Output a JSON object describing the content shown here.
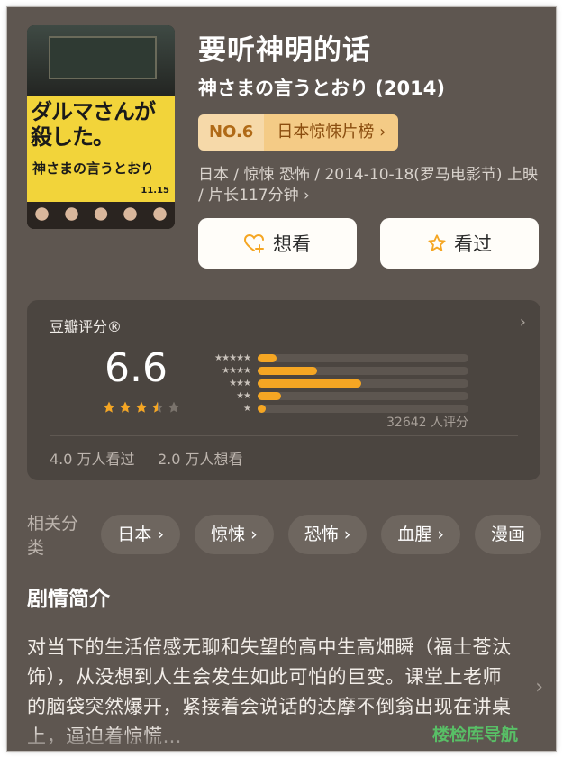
{
  "movie": {
    "title": "要听神明的话",
    "original_title": "神さまの言うとおり (2014)",
    "rank_no": "NO.6",
    "rank_list": "日本惊悚片榜 ›",
    "meta": "日本 / 惊悚 恐怖 / 2014-10-18(罗马电影节) 上映 / 片长117分钟 ›",
    "want_label": "想看",
    "seen_label": "看过",
    "poster": {
      "jp_headline": "ダルマさんが殺した。",
      "jp_title": "神さまの言うとおり",
      "release": "11.15"
    }
  },
  "rating": {
    "label": "豆瓣评分®",
    "score": "6.6",
    "stars": 3.5,
    "distribution": [
      0.09,
      0.28,
      0.49,
      0.11,
      0.04
    ],
    "votes": "32642 人评分",
    "seen_count": "4.0 万人看过",
    "want_count": "2.0 万人想看",
    "chevron": "›"
  },
  "tags": {
    "label": "相关分类",
    "items": [
      "日本 ›",
      "惊悚 ›",
      "恐怖 ›",
      "血腥 ›",
      "漫画"
    ]
  },
  "synopsis": {
    "heading": "剧情简介",
    "text": "对当下的生活倍感无聊和失望的高中生高畑瞬（福士苍汰 饰），从没想到人生会发生如此可怕的巨变。课堂上老师的脑袋突然爆开，紧接着会说话的达摩不倒翁出现在讲桌上，逼迫着惊慌…",
    "chevron": "›"
  },
  "watermark": "楼检库导航",
  "colors": {
    "background": "#5e5650",
    "accent": "#f5a623",
    "card": "#4b4540"
  }
}
